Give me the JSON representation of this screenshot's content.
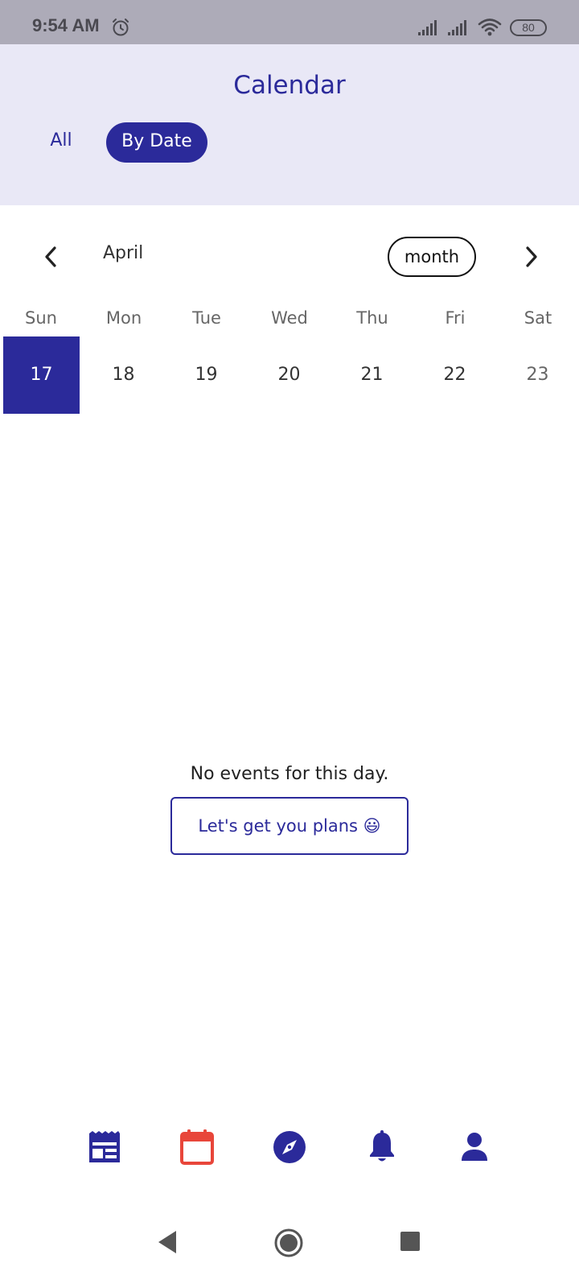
{
  "status_bar": {
    "time": "9:54 AM",
    "battery": "80"
  },
  "header": {
    "title": "Calendar",
    "tabs": [
      {
        "label": "All",
        "active": false
      },
      {
        "label": "By Date",
        "active": true
      }
    ]
  },
  "calendar": {
    "month": "April",
    "view_toggle": "month",
    "weekdays": [
      "Sun",
      "Mon",
      "Tue",
      "Wed",
      "Thu",
      "Fri",
      "Sat"
    ],
    "dates": [
      "17",
      "18",
      "19",
      "20",
      "21",
      "22",
      "23"
    ],
    "selected_date": "17"
  },
  "empty_state": {
    "message": "No events for this day.",
    "button_label": "Let's get you plans 😃"
  },
  "bottom_nav": {
    "items": [
      {
        "icon": "news-icon",
        "active": false
      },
      {
        "icon": "calendar-icon",
        "active": true
      },
      {
        "icon": "compass-icon",
        "active": false
      },
      {
        "icon": "bell-icon",
        "active": false
      },
      {
        "icon": "profile-icon",
        "active": false
      }
    ]
  },
  "colors": {
    "primary": "#2b2a9a",
    "header_bg": "#e9e8f6",
    "active_nav": "#e8463a",
    "status_bar_bg": "#adabb8"
  }
}
